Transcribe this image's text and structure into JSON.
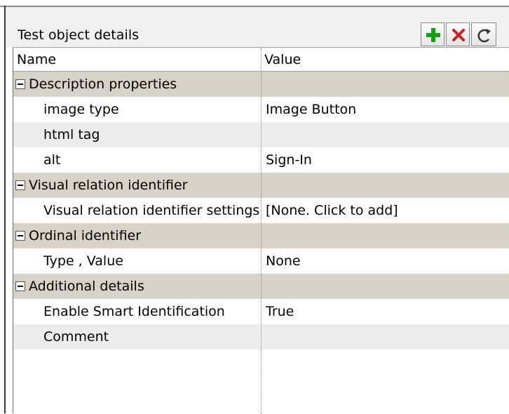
{
  "panel": {
    "title": "Test object details",
    "toolbar": {
      "add_icon": "plus-icon",
      "remove_icon": "x-icon",
      "reset_icon": "refresh-icon"
    }
  },
  "table": {
    "headers": [
      "Name",
      "Value"
    ],
    "rows": [
      {
        "type": "category",
        "name": "Description properties",
        "value": ""
      },
      {
        "type": "property",
        "name": "image type",
        "value": "Image Button"
      },
      {
        "type": "property",
        "name": "html tag",
        "value": ""
      },
      {
        "type": "property",
        "name": "alt",
        "value": "Sign-In"
      },
      {
        "type": "category",
        "name": "Visual relation identifier",
        "value": ""
      },
      {
        "type": "property",
        "name": "Visual relation identifier settings",
        "value": "[None. Click to add]"
      },
      {
        "type": "category",
        "name": "Ordinal identifier",
        "value": ""
      },
      {
        "type": "property",
        "name": "Type , Value",
        "value": "None"
      },
      {
        "type": "category",
        "name": "Additional details",
        "value": ""
      },
      {
        "type": "property",
        "name": "Enable Smart Identification",
        "value": "True"
      },
      {
        "type": "property",
        "name": "Comment",
        "value": ""
      }
    ]
  },
  "colors": {
    "category_row": "#d6d2c8",
    "alt_row": "#ececec",
    "plus_green": "#1a9b1a",
    "x_red": "#d01f1f"
  }
}
